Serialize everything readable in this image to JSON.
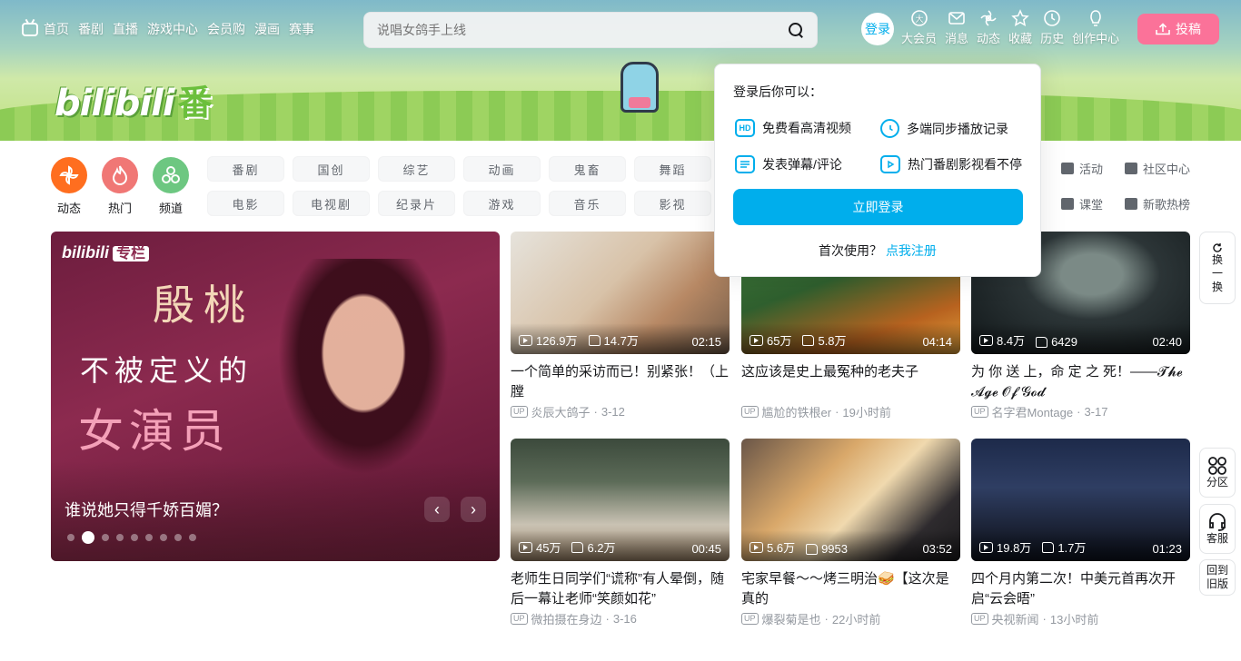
{
  "header": {
    "nav": [
      "首页",
      "番剧",
      "直播",
      "游戏中心",
      "会员购",
      "漫画",
      "赛事"
    ],
    "search_placeholder": "说唱女鸽手上线",
    "login_label": "登录",
    "entries": [
      {
        "label": "大会员",
        "icon": "vip-icon"
      },
      {
        "label": "消息",
        "icon": "message-icon"
      },
      {
        "label": "动态",
        "icon": "dynamic-icon"
      },
      {
        "label": "收藏",
        "icon": "favorite-icon"
      },
      {
        "label": "历史",
        "icon": "history-icon"
      },
      {
        "label": "创作中心",
        "icon": "creator-icon"
      }
    ],
    "upload_label": "投稿"
  },
  "channels": {
    "big": [
      {
        "label": "动态",
        "color": "#ff6e1f"
      },
      {
        "label": "热门",
        "color": "#f07775"
      },
      {
        "label": "频道",
        "color": "#6dc781"
      }
    ],
    "chips": [
      "番剧",
      "国创",
      "综艺",
      "动画",
      "鬼畜",
      "舞蹈",
      "电影",
      "电视剧",
      "纪录片",
      "游戏",
      "音乐",
      "影视"
    ],
    "side": [
      "活动",
      "社区中心",
      "课堂",
      "新歌热榜"
    ]
  },
  "carousel": {
    "brand": "bilibili",
    "column": "专栏",
    "poster_line1": "殷桃",
    "poster_line2": "不被定义的",
    "poster_line3": "女演员",
    "caption": "谁说她只得千娇百媚？",
    "active_dot": 2,
    "dot_count": 9
  },
  "videos": [
    {
      "plays": "126.9万",
      "likes": "14.7万",
      "duration": "02:15",
      "title": "一个简单的采访而已！别紧张！（上膛",
      "author": "炎辰大鸽子",
      "date": "3-12"
    },
    {
      "plays": "65万",
      "likes": "5.8万",
      "duration": "04:14",
      "title": "这应该是史上最冤种的老夫子",
      "author": "尴尬的铁根er",
      "date": "19小时前"
    },
    {
      "plays": "8.4万",
      "likes": "6429",
      "duration": "02:40",
      "title": "为 你 送 上，命 定 之 死！——𝓣𝓱𝓮 𝓐𝓰𝓮 𝓞𝓯 𝓖𝓸𝓭",
      "author": "名字君Montage",
      "date": "3-17"
    },
    {
      "plays": "45万",
      "likes": "6.2万",
      "duration": "00:45",
      "title": "老师生日同学们“谎称”有人晕倒，随后一幕让老师“笑颜如花”",
      "author": "微拍摄在身边",
      "date": "3-16"
    },
    {
      "plays": "5.6万",
      "likes": "9953",
      "duration": "03:52",
      "title": "宅家早餐～～烤三明治🥪【这次是真的",
      "author": "爆裂菊是也",
      "date": "22小时前"
    },
    {
      "plays": "19.8万",
      "likes": "1.7万",
      "duration": "01:23",
      "title": "四个月内第二次！中美元首再次开启“云会晤”",
      "author": "央视新闻",
      "date": "13小时前"
    }
  ],
  "popover": {
    "heading": "登录后你可以：",
    "features": [
      "免费看高清视频",
      "多端同步播放记录",
      "发表弹幕/评论",
      "热门番剧影视看不停"
    ],
    "hd_badge": "HD",
    "login_button": "立即登录",
    "first_time": "首次使用？",
    "register_link": "点我注册"
  },
  "float_buttons": {
    "refresh": "换一换",
    "category": "分区",
    "service": "客服",
    "old_version": "回到旧版"
  }
}
